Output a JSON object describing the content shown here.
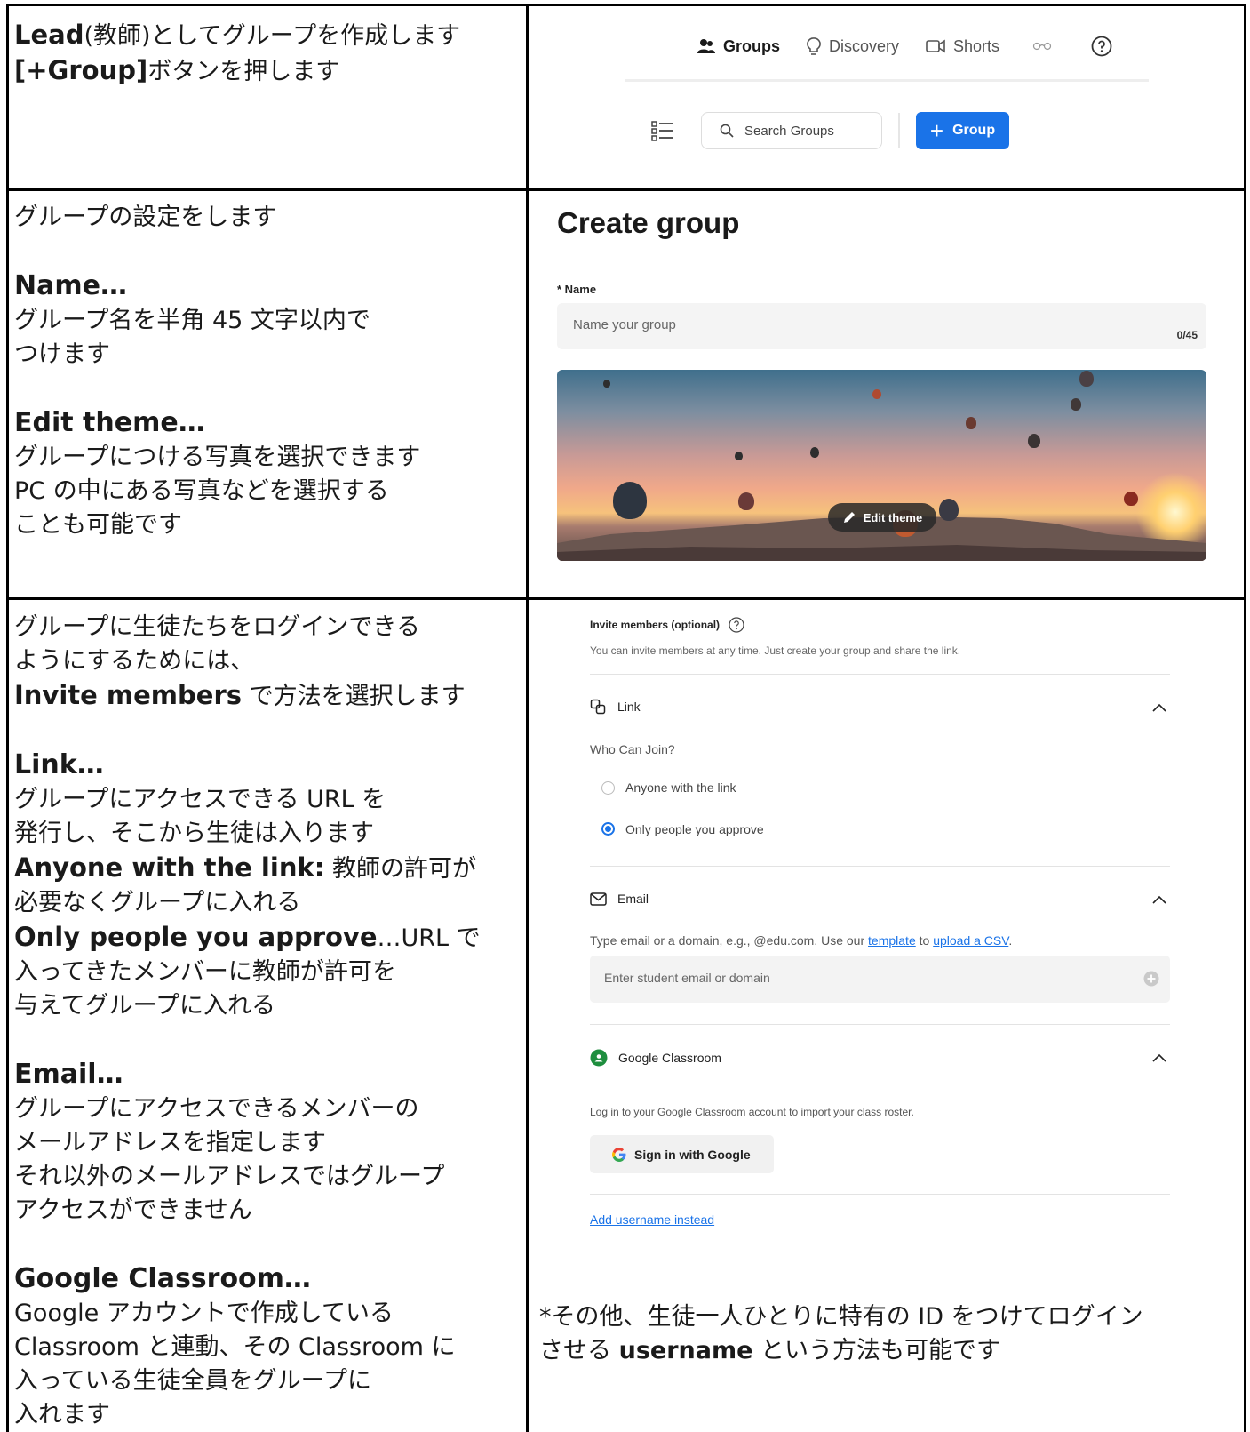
{
  "row1": {
    "left": {
      "line1_bold": "Lead",
      "line1_rest": "(教師)としてグループを作成します",
      "line2_bold": "[+Group]",
      "line2_rest": "ボタンを押します"
    },
    "nav": {
      "groups": "Groups",
      "discovery": "Discovery",
      "shorts": "Shorts"
    },
    "search_placeholder": "Search Groups",
    "add_group_label": "Group"
  },
  "row2": {
    "left": {
      "intro": "グループの設定をします",
      "name_heading": "Name…",
      "name_l1": "グループ名を半角 45 文字以内で",
      "name_l2": "つけます",
      "theme_heading": "Edit theme…",
      "theme_l1": "グループにつける写真を選択できます",
      "theme_l2": "PC の中にある写真などを選択する",
      "theme_l3": "ことも可能です"
    },
    "title": "Create group",
    "name_label": "* Name",
    "name_placeholder": "Name your group",
    "name_counter": "0/45",
    "edit_theme_label": "Edit theme"
  },
  "row3": {
    "left": {
      "l1": "グループに生徒たちをログインできる",
      "l2": "ようにするためには、",
      "l3_bold": "Invite members",
      "l3_rest": " で方法を選択します",
      "link_heading": "Link…",
      "link_l1": "グループにアクセスできる URL を",
      "link_l2": "発行し、そこから生徒は入ります",
      "anyone_bold": "Anyone with the link:",
      "anyone_rest": " 教師の許可が",
      "anyone_l2": "必要なくグループに入れる",
      "only_bold": "Only people you approve",
      "only_rest": "…URL で",
      "only_l2": "入ってきたメンバーに教師が許可を",
      "only_l3": "与えてグループに入れる",
      "email_heading": "Email…",
      "email_l1": "グループにアクセスできるメンバーの",
      "email_l2": "メールアドレスを指定します",
      "email_l3": "それ以外のメールアドレスではグループ",
      "email_l4": "アクセスができません",
      "gc_heading": "Google Classroom…",
      "gc_l1": "Google アカウントで作成している",
      "gc_l2": "Classroom と連動、その Classroom に",
      "gc_l3": "入っている生徒全員をグループに",
      "gc_l4": "入れます"
    },
    "invite_title": "Invite members (optional)",
    "invite_sub": "You can invite members at any time. Just create your group and share the link.",
    "link_title": "Link",
    "who_can_join": "Who Can Join?",
    "opt_anyone": "Anyone with the link",
    "opt_only": "Only people you approve",
    "email_title": "Email",
    "email_desc_pre": "Type email or a domain, e.g., @edu.com. Use our ",
    "email_template": "template",
    "email_to": " to ",
    "email_csv": "upload a CSV",
    "email_period": ".",
    "email_placeholder": "Enter student email or domain",
    "gc_title": "Google Classroom",
    "gc_desc": "Log in to your Google Classroom account to import your class roster.",
    "google_btn": "Sign in with Google",
    "add_username": "Add username instead",
    "note_l1": "*その他、生徒一人ひとりに特有の ID をつけてログイン",
    "note_l2_pre": "させる ",
    "note_l2_bold": "username",
    "note_l2_rest": " という方法も可能です"
  }
}
